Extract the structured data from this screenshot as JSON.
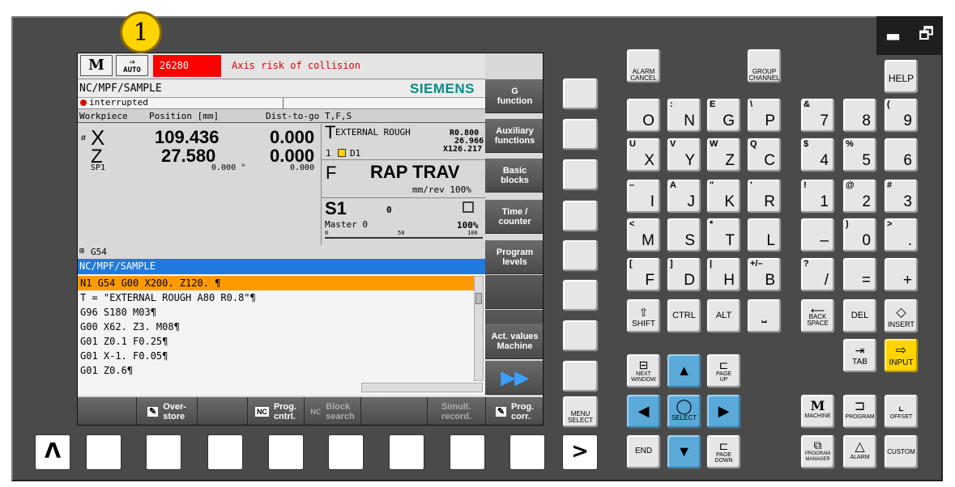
{
  "badge": "1",
  "window_controls": {
    "minimize": "▬",
    "restore": "🗗"
  },
  "titlebar": {
    "mode_icon_top": "M",
    "auto_top": "⇒",
    "auto_bottom": "AUTO",
    "alarm_number": "26280",
    "alarm_text": "Axis  risk of collision"
  },
  "program_path": "NC/MPF/SAMPLE",
  "brand": "SIEMENS",
  "status": "interrupted",
  "headers": {
    "workpiece": "Workpiece",
    "position": "Position [mm]",
    "dist": "Dist-to-go",
    "tfs": "T,F,S"
  },
  "axes": [
    {
      "name": "X",
      "prefix": "ø",
      "pos": "109.436",
      "dist": "0.000"
    },
    {
      "name": "Z",
      "prefix": "",
      "pos": "27.580",
      "dist": "0.000"
    },
    {
      "name": "SP1",
      "prefix": "",
      "pos": "0.000 °",
      "dist": "0.000"
    }
  ],
  "tool": {
    "t_letter": "T",
    "name": "EXTERNAL ROUGH",
    "r": "R0.800",
    "z": "26.966",
    "x": "X126.217",
    "num": "1",
    "d": "D1"
  },
  "feed": {
    "f_letter": "F",
    "text": "RAP TRAV",
    "unit": "mm/rev 100%"
  },
  "spindle": {
    "name": "S1",
    "value": "0",
    "master": "Master  0",
    "pct": "100%",
    "scale0": "0",
    "scale50": "50",
    "scale100": "100"
  },
  "zero_offset": "G54",
  "editor": {
    "title": "NC/MPF/SAMPLE",
    "lines": [
      "N1 G54 G00 X200. Z120. ¶",
      "T = \"EXTERNAL ROUGH A80 R0.8\"¶",
      "G96 S180 M03¶",
      "G00 X62. Z3. M08¶",
      "G01 Z0.1 F0.25¶",
      "G01 X-1. F0.05¶",
      "G01 Z0.6¶"
    ]
  },
  "vsoftkeys": [
    "G\nfunction",
    "Auxiliary\nfunctions",
    "Basic\nblocks",
    "Time /\ncounter",
    "Program\nlevels",
    "",
    "",
    "Act. values\nMachine",
    "▶▶"
  ],
  "hsoftkeys": {
    "override": "Over-\nstore",
    "prog_ctrl": "Prog.\ncntrl.",
    "block": "Block\nsearch",
    "simult": "Simult.\nrecord.",
    "prog_corr": "Prog.\ncorr."
  },
  "keys": {
    "alarm_cancel": "ALARM\nCANCEL",
    "group_channel": "GROUP\nCHANNEL",
    "help": "HELP",
    "r1": [
      [
        "",
        "O"
      ],
      [
        ":",
        "N"
      ],
      [
        "E",
        "G"
      ],
      [
        "\\",
        "P"
      ],
      [
        "&",
        "7"
      ],
      [
        "",
        "8"
      ],
      [
        "(",
        "9"
      ]
    ],
    "r2": [
      [
        "U",
        "X"
      ],
      [
        "V",
        "Y"
      ],
      [
        "W",
        "Z"
      ],
      [
        "Q",
        "C"
      ],
      [
        "$",
        "4"
      ],
      [
        "%",
        "5"
      ],
      [
        "",
        "6"
      ]
    ],
    "r3": [
      [
        "–",
        "I"
      ],
      [
        "A",
        "J"
      ],
      [
        "\"",
        "K"
      ],
      [
        "'",
        "R"
      ],
      [
        "!",
        "1"
      ],
      [
        "@",
        "2"
      ],
      [
        "#",
        "3"
      ]
    ],
    "r4": [
      [
        "<",
        "M"
      ],
      [
        "",
        "S"
      ],
      [
        "*",
        "T"
      ],
      [
        "",
        "L"
      ],
      [
        "",
        "–"
      ],
      [
        ")",
        "0"
      ],
      [
        ">",
        "."
      ]
    ],
    "r5": [
      [
        "[",
        "F"
      ],
      [
        "]",
        "D"
      ],
      [
        "|",
        "H"
      ],
      [
        "+/–",
        "B"
      ],
      [
        "?",
        "/"
      ],
      [
        "",
        "="
      ],
      [
        "",
        "+"
      ]
    ],
    "shift": "SHIFT",
    "ctrl": "CTRL",
    "alt": "ALT",
    "backspace": "BACK\nSPACE",
    "del": "DEL",
    "insert": "INSERT",
    "tab": "TAB",
    "input": "INPUT",
    "next_window": "NEXT\nWINDOW",
    "page_up": "PAGE\nUP",
    "page_down": "PAGE\nDOWN",
    "select": "SELECT",
    "end": "END",
    "menu_select": "MENU\nSELECT",
    "machine": "MACHINE",
    "program": "PROGRAM",
    "offset": "OFFSET",
    "program_manager": "PROGRAM\nMANAGER",
    "alarm": "ALARM",
    "custom": "CUSTOM",
    "recall": "Λ",
    "etc": ">"
  }
}
